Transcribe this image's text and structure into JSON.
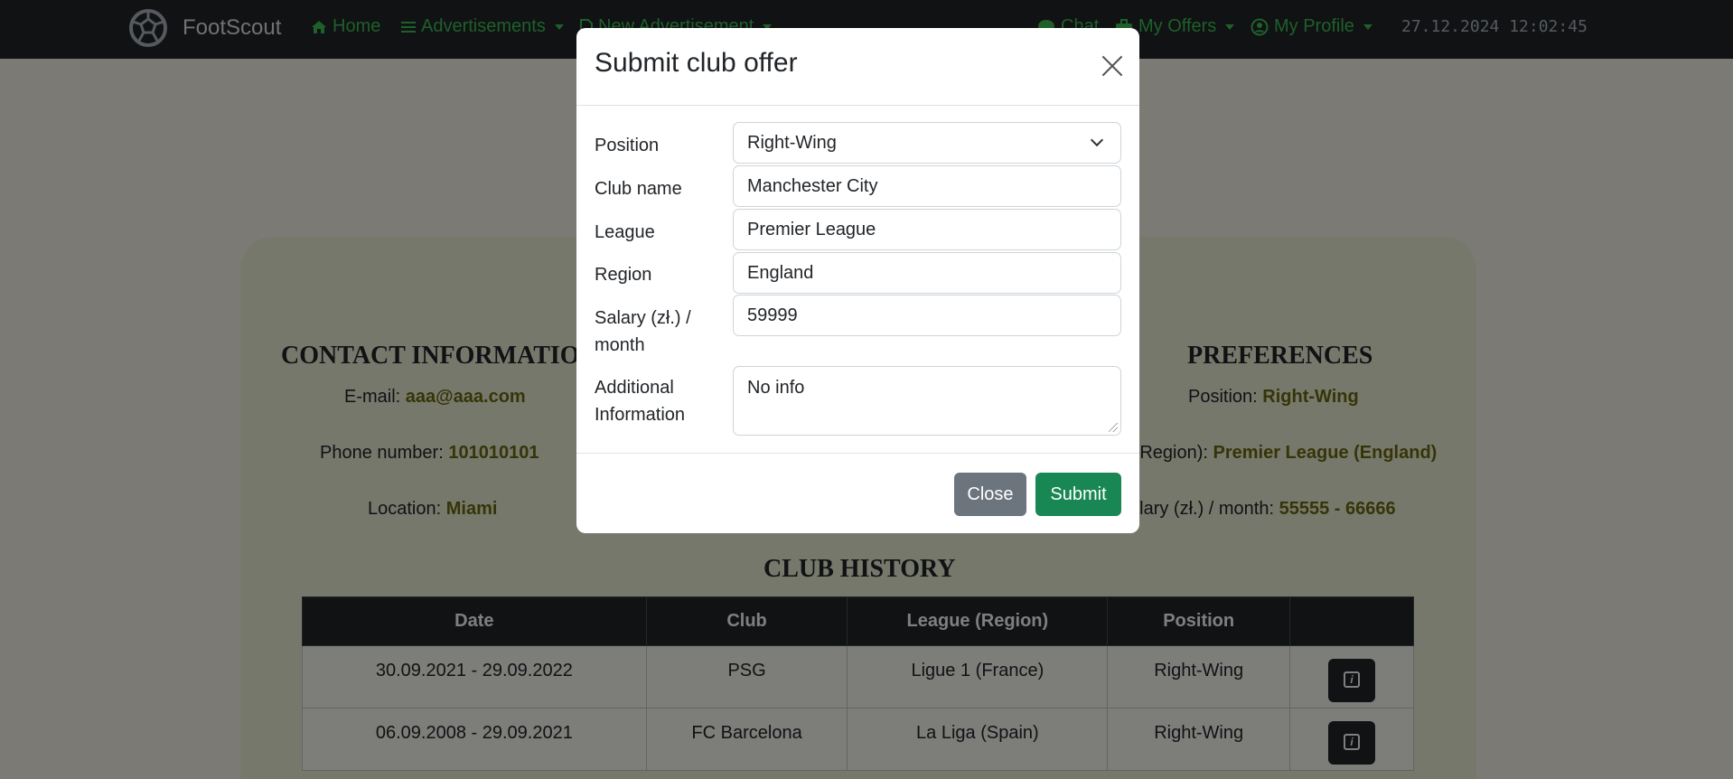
{
  "navbar": {
    "brand": "FootScout",
    "home": "Home",
    "advertisements": "Advertisements",
    "new_advertisement": "New Advertisement",
    "chat": "Chat",
    "my_offers": "My Offers",
    "my_profile": "My Profile",
    "datetime": "27.12.2024 12:02:45"
  },
  "contact": {
    "title": "CONTACT INFORMATION",
    "email_label": "E-mail: ",
    "email": "aaa@aaa.com",
    "phone_label": "Phone number: ",
    "phone": "101010101",
    "location_label": "Location: ",
    "location": "Miami"
  },
  "preferences": {
    "title": "PREFERENCES",
    "position_label": "Position: ",
    "position": "Right-Wing",
    "league_label": "e (Region): ",
    "league": "Premier League (England)",
    "salary_label": "alary (zł.) / month: ",
    "salary": "55555 - 66666"
  },
  "club_history": {
    "title": "CLUB HISTORY",
    "columns": [
      "Date",
      "Club",
      "League (Region)",
      "Position",
      ""
    ],
    "rows": [
      {
        "date": "30.09.2021 - 29.09.2022",
        "club": "PSG",
        "league": "Ligue 1 (France)",
        "position": "Right-Wing"
      },
      {
        "date": "06.09.2008 - 29.09.2021",
        "club": "FC Barcelona",
        "league": "La Liga (Spain)",
        "position": "Right-Wing"
      }
    ]
  },
  "modal": {
    "title": "Submit club offer",
    "position_label": "Position",
    "position_value": "Right-Wing",
    "club_label": "Club name",
    "club_value": "Manchester City",
    "league_label": "League",
    "league_value": "Premier League",
    "region_label": "Region",
    "region_value": "England",
    "salary_label_1": "Salary (zł.) /",
    "salary_label_2": "month",
    "salary_value": "59999",
    "info_label_1": "Additional",
    "info_label_2": "Information",
    "info_value": "No info",
    "close_label": "Close",
    "submit_label": "Submit"
  }
}
